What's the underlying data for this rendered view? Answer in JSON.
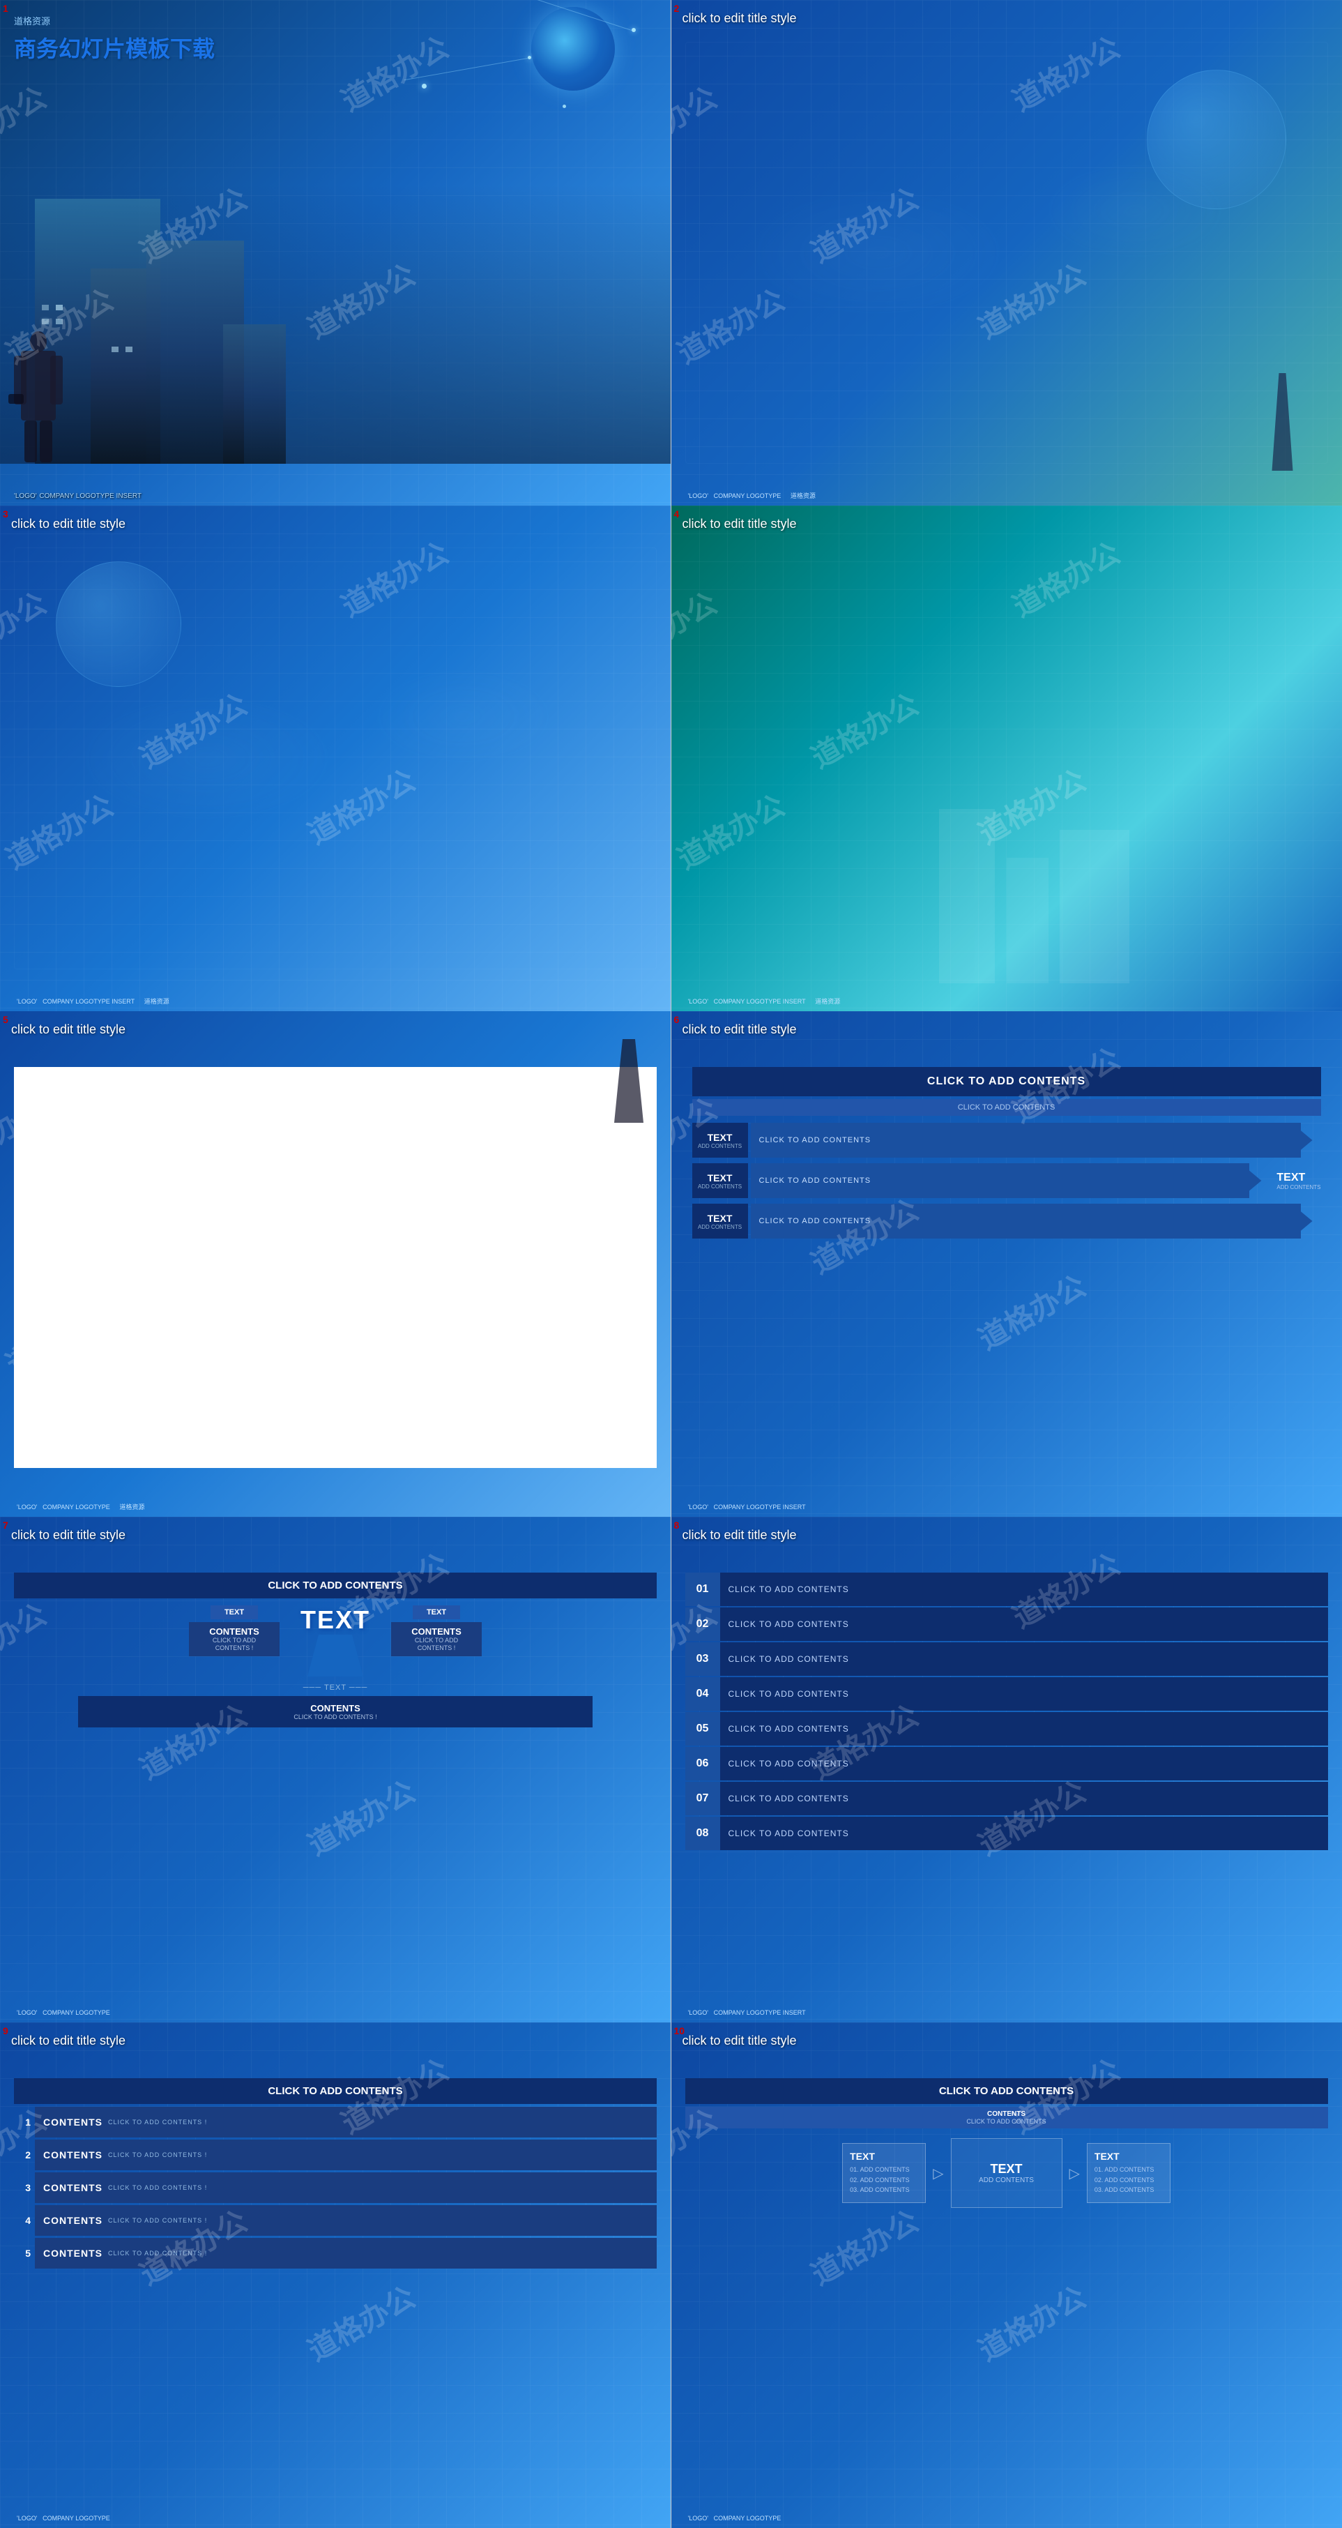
{
  "slides": [
    {
      "id": 1,
      "num": "1",
      "subtitle": "道格资源",
      "title": "商务幻灯片模板下载",
      "logo": "'LOGO'",
      "logo_sub": "COMPANY LOGOTYPE INSERT"
    },
    {
      "id": 2,
      "num": "2",
      "title": "click to edit title style",
      "logo": "'LOGO'",
      "logo_sub": "COMPANY LOGOTYPE",
      "url": "道格资源"
    },
    {
      "id": 3,
      "num": "3",
      "title": "click to edit title style",
      "logo": "'LOGO'",
      "logo_sub": "COMPANY LOGOTYPE INSERT",
      "url": "道格资源"
    },
    {
      "id": 4,
      "num": "4",
      "title": "click to edit title style",
      "logo": "'LOGO'",
      "logo_sub": "COMPANY LOGOTYPE INSERT",
      "url": "道格资源"
    },
    {
      "id": 5,
      "num": "5",
      "title": "click to edit title style",
      "logo": "'LOGO'",
      "logo_sub": "COMPANY LOGOTYPE",
      "url": "道格资源"
    },
    {
      "id": 6,
      "num": "6",
      "title": "click to edit title style",
      "header": "CLICK TO ADD CONTENTS",
      "subheader": "CLICK TO ADD CONTENTS",
      "rows": [
        {
          "label": "TEXT",
          "sub": "ADD CONTENTS",
          "bar": "CLICK TO ADD CONTENTS"
        },
        {
          "label": "TEXT",
          "sub": "ADD CONTENTS",
          "bar": "CLICK TO ADD CONTENTS"
        },
        {
          "label": "TEXT",
          "sub": "ADD CONTENTS",
          "bar": "CLICK TO ADD CONTENTS"
        }
      ],
      "right_text": "TEXT",
      "right_sub": "ADD CONTENTS",
      "logo": "'LOGO'",
      "logo_sub": "COMPANY LOGOTYPE INSERT"
    },
    {
      "id": 7,
      "num": "7",
      "title": "click to edit title style",
      "header": "CLICK TO ADD CONTENTS",
      "col1_label": "TEXT",
      "col1_content": "CONTENTS",
      "col1_sub": "CLICK TO ADD CONTENTS !",
      "col2_label": "TEXT",
      "col2_content": "CONTENTS",
      "col2_sub": "CLICK TO ADD CONTENTS !",
      "arrow_text": "TEXT",
      "bottom_title": "CONTENTS",
      "bottom_sub": "CLICK TO ADD CONTENTS !",
      "logo": "'LOGO'",
      "logo_sub": "COMPANY LOGOTYPE"
    },
    {
      "id": 8,
      "num": "8",
      "title": "click to edit title style",
      "header": "CLICK TO ADD CONTENTS",
      "items": [
        {
          "num": "01",
          "text": "CLICK TO ADD CONTENTS"
        },
        {
          "num": "02",
          "text": "CLICK TO ADD CONTENTS"
        },
        {
          "num": "03",
          "text": "CLICK TO ADD CONTENTS"
        },
        {
          "num": "04",
          "text": "CLICK TO ADD CONTENTS"
        },
        {
          "num": "05",
          "text": "CLICK TO ADD CONTENTS"
        },
        {
          "num": "06",
          "text": "CLICK TO ADD CONTENTS"
        },
        {
          "num": "07",
          "text": "CLICK TO ADD CONTENTS"
        },
        {
          "num": "08",
          "text": "CLICK TO ADD CONTENTS"
        }
      ],
      "logo": "'LOGO'",
      "logo_sub": "COMPANY LOGOTYPE INSERT"
    },
    {
      "id": 9,
      "num": "9",
      "title": "click to edit title style",
      "header": "CLICK TO ADD CONTENTS",
      "items": [
        {
          "num": "1",
          "title": "CONTENTS",
          "sub": "CLICK TO ADD CONTENTS !"
        },
        {
          "num": "2",
          "title": "CONTENTS",
          "sub": "CLICK TO ADD CONTENTS !"
        },
        {
          "num": "3",
          "title": "CONTENTS",
          "sub": "CLICK TO ADD CONTENTS !"
        },
        {
          "num": "4",
          "title": "CONTENTS",
          "sub": "CLICK TO ADD CONTENTS !"
        },
        {
          "num": "5",
          "title": "CONTENTS",
          "sub": "CLICK TO ADD CONTENTS !"
        }
      ],
      "logo": "'LOGO'",
      "logo_sub": "COMPANY LOGOTYPE"
    },
    {
      "id": 10,
      "num": "10",
      "title": "click to edit title style",
      "header": "CLICK TO ADD CONTENTS",
      "sub": "CONTENTS\nCLICK TO ADD CONTENTS",
      "left_title": "TEXT",
      "left_items": "01. ADD CONTENTS\n02. ADD CONTENTS\n03. ADD CONTENTS",
      "center_title": "TEXT",
      "center_sub": "ADD CONTENTS",
      "right_title": "TEXT",
      "right_items": "01. ADD CONTENTS\n02. ADD CONTENTS\n03. ADD CONTENTS",
      "logo": "'LOGO'",
      "logo_sub": "COMPANY LOGOTYPE"
    }
  ],
  "watermark": {
    "lines": [
      "道格办公",
      "道格办公",
      "道格办公",
      "道格办公",
      "道格办公"
    ]
  },
  "colors": {
    "dark_blue": "#0d2d6e",
    "mid_blue": "#1565c0",
    "light_blue": "#42a5f5",
    "accent": "#cc0000",
    "white": "#ffffff"
  }
}
